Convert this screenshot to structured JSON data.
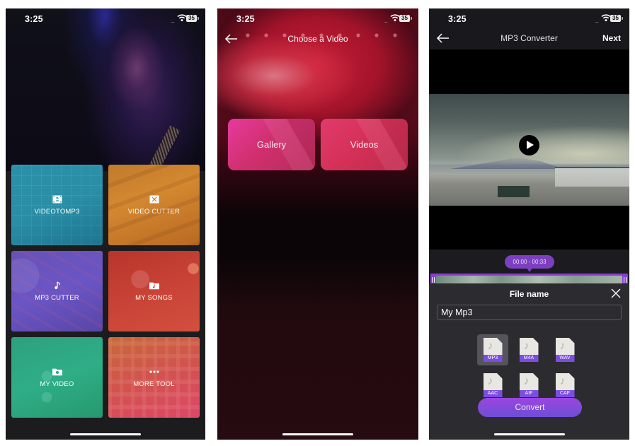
{
  "status_bar": {
    "time": "3:25",
    "signal": "....",
    "battery": "35"
  },
  "screen_home": {
    "tiles": [
      {
        "label": "VIDEOTOMP3",
        "icon": "film-convert-icon",
        "color": "#2a91a8"
      },
      {
        "label": "VIDEO CUTTER",
        "icon": "film-scissors-icon",
        "color": "#d48830"
      },
      {
        "label": "MP3 CUTTER",
        "icon": "music-scissors-icon",
        "color": "#6a55c5"
      },
      {
        "label": "MY SONGS",
        "icon": "music-folder-icon",
        "color": "#c84336"
      },
      {
        "label": "MY VIDEO",
        "icon": "video-folder-icon",
        "color": "#2fae86"
      },
      {
        "label": "MORE TOOL",
        "icon": "more-dots-icon",
        "color": "#d2524f"
      }
    ]
  },
  "screen_choose": {
    "title": "Choose a Video",
    "options": [
      {
        "label": "Gallery"
      },
      {
        "label": "Videos"
      }
    ]
  },
  "screen_converter": {
    "title": "MP3 Converter",
    "next_label": "Next",
    "time_range": "00:00 - 00:33",
    "sheet_title": "File name",
    "file_name_value": "My Mp3",
    "formats": [
      "MP3",
      "M4A",
      "WAV",
      "AAC",
      "AIF",
      "CAF"
    ],
    "selected_format": "MP3",
    "convert_label": "Convert",
    "accent": "#7d3fc2"
  }
}
